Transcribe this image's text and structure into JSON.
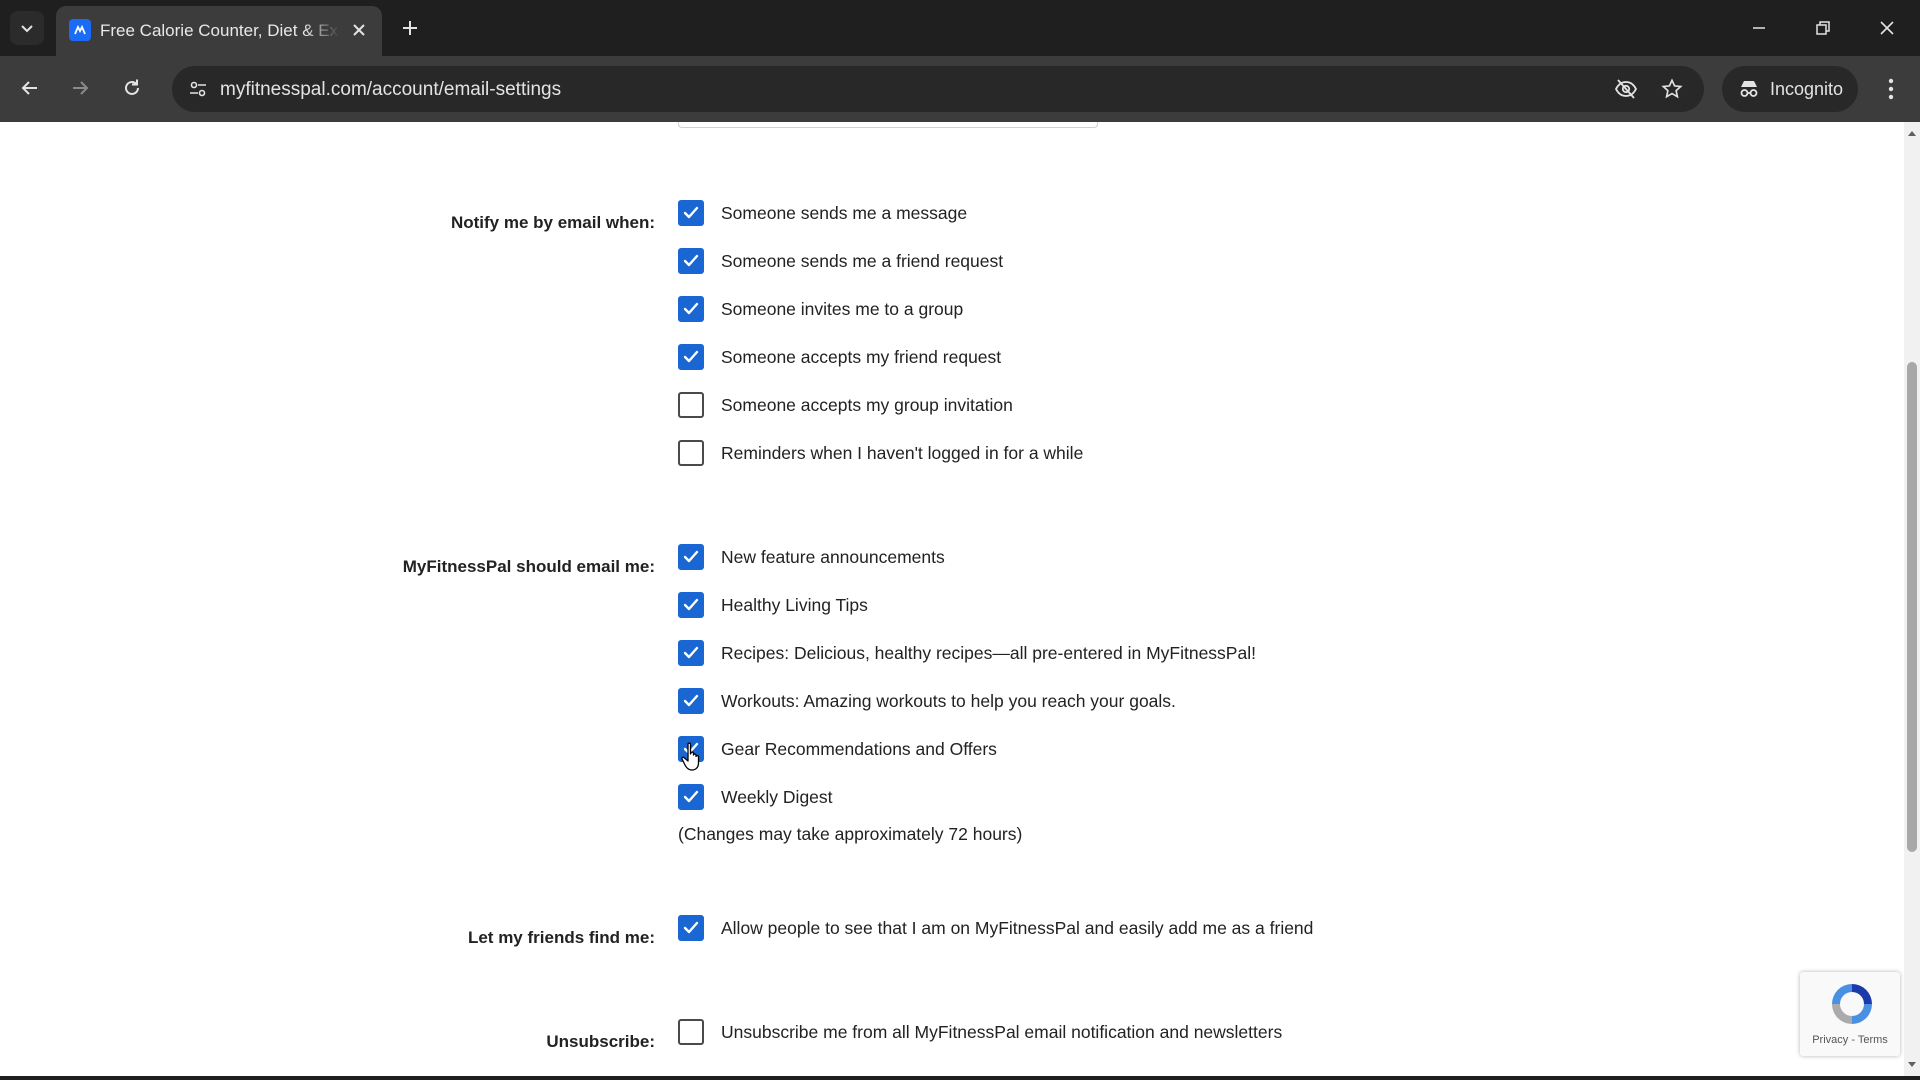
{
  "browser": {
    "tab_title": "Free Calorie Counter, Diet & Exercise Journal",
    "url": "myfitnesspal.com/account/email-settings",
    "incognito_label": "Incognito"
  },
  "settings": {
    "notify": {
      "label": "Notify me by email when:",
      "options": [
        {
          "label": "Someone sends me a message",
          "checked": true
        },
        {
          "label": "Someone sends me a friend request",
          "checked": true
        },
        {
          "label": "Someone invites me to a group",
          "checked": true
        },
        {
          "label": "Someone accepts my friend request",
          "checked": true
        },
        {
          "label": "Someone accepts my group invitation",
          "checked": false
        },
        {
          "label": "Reminders when I haven't logged in for a while",
          "checked": false
        }
      ]
    },
    "mfp_email": {
      "label": "MyFitnessPal should email me:",
      "options": [
        {
          "label": "New feature announcements",
          "checked": true
        },
        {
          "label": "Healthy Living Tips",
          "checked": true
        },
        {
          "label": "Recipes: Delicious, healthy recipes—all pre-entered in MyFitnessPal!",
          "checked": true
        },
        {
          "label": "Workouts: Amazing workouts to help you reach your goals.",
          "checked": true
        },
        {
          "label": "Gear Recommendations and Offers",
          "checked": true
        },
        {
          "label": "Weekly Digest",
          "checked": true
        }
      ],
      "note": "(Changes may take approximately 72 hours)"
    },
    "friends": {
      "label": "Let my friends find me:",
      "options": [
        {
          "label": "Allow people to see that I am on MyFitnessPal and easily add me as a friend",
          "checked": true
        }
      ]
    },
    "unsubscribe": {
      "label": "Unsubscribe:",
      "options": [
        {
          "label": "Unsubscribe me from all MyFitnessPal email notification and newsletters",
          "checked": false
        }
      ]
    }
  },
  "recaptcha": {
    "links": "Privacy - Terms"
  },
  "colors": {
    "checkbox_checked": "#1a66d2",
    "chrome_dark": "#1f1f1f",
    "toolbar": "#3c3c3c"
  }
}
